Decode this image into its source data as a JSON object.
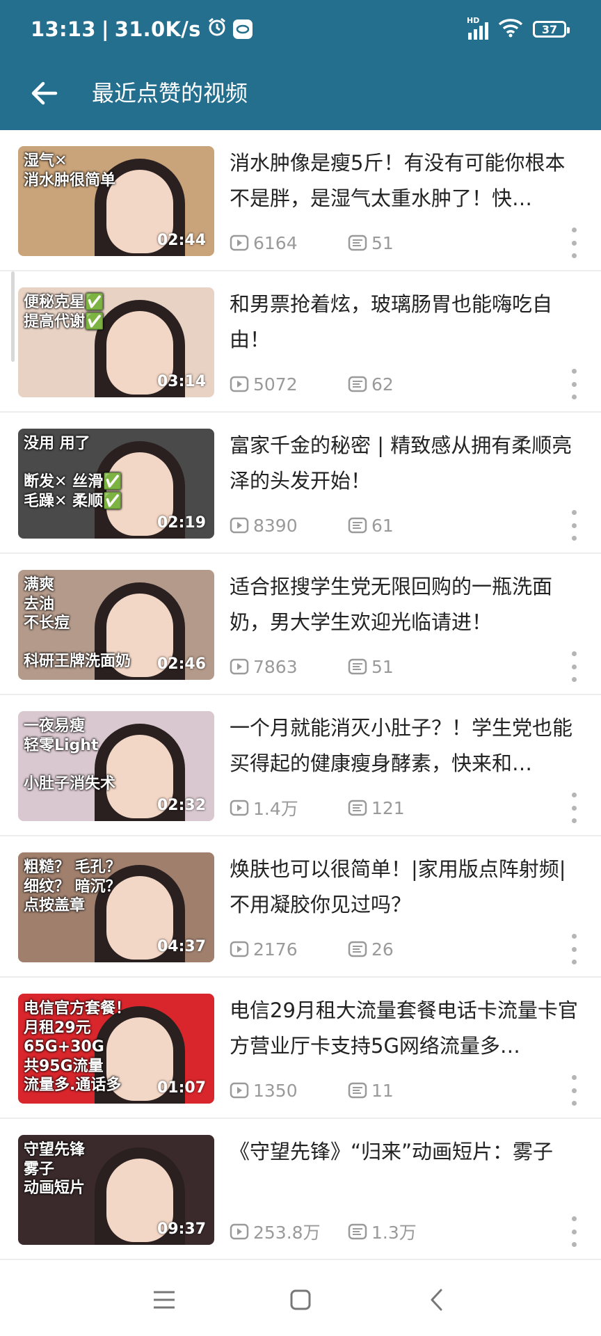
{
  "status_bar": {
    "time": "13:13",
    "separator": "|",
    "speed": "31.0K/s",
    "network": "HD",
    "battery": "37"
  },
  "header": {
    "title": "最近点赞的视频",
    "back_icon": "arrow-left-icon"
  },
  "colors": {
    "topbar": "#246e8e",
    "text": "#222222",
    "meta": "#9a9a9a"
  },
  "videos": [
    {
      "title": "消水肿像是瘦5斤！有没有可能你根本不是胖，是湿气太重水肿了！快…",
      "duration": "02:44",
      "views": "6164",
      "comments": "51",
      "thumb_text": "湿气✕\n消水肿很简单",
      "thumb_bg": "#c9a37a"
    },
    {
      "title": "和男票抢着炫，玻璃肠胃也能嗨吃自由！",
      "duration": "03:14",
      "views": "5072",
      "comments": "62",
      "thumb_text": "便秘克星✅\n提高代谢✅",
      "thumb_bg": "#e8d2c4"
    },
    {
      "title": "富家千金的秘密 | 精致感从拥有柔顺亮泽的头发开始！",
      "duration": "02:19",
      "views": "8390",
      "comments": "61",
      "thumb_text": "没用          用了\n\n断发✕    丝滑✅\n毛躁✕    柔顺✅",
      "thumb_bg": "#4a4a4a"
    },
    {
      "title": "适合抠搜学生党无限回购的一瓶洗面奶，男大学生欢迎光临请进！",
      "duration": "02:46",
      "views": "7863",
      "comments": "51",
      "thumb_text": "满爽\n去油\n不长痘\n\n科研王牌洗面奶",
      "thumb_bg": "#b49a8a"
    },
    {
      "title": "一个月就能消灭小肚子？！学生党也能买得起的健康瘦身酵素，快来和…",
      "duration": "02:32",
      "views": "1.4万",
      "comments": "121",
      "thumb_text": "一夜易瘦\n轻零Light\n\n小肚子消失术",
      "thumb_bg": "#d9c8cf"
    },
    {
      "title": "焕肤也可以很简单！|家用版点阵射频|不用凝胶你见过吗？",
      "duration": "04:37",
      "views": "2176",
      "comments": "26",
      "thumb_text": "粗糙？   毛孔？\n细纹？   暗沉？\n点按盖章",
      "thumb_bg": "#a07f6d"
    },
    {
      "title": "电信29月租大流量套餐电话卡流量卡官方营业厅卡支持5G网络流量多…",
      "duration": "01:07",
      "views": "1350",
      "comments": "11",
      "thumb_text": "电信官方套餐！\n月租29元\n65G+30G\n共95G流量\n流量多.通话多",
      "thumb_bg": "#d8262c"
    },
    {
      "title": "《守望先锋》“归来”动画短片：雾子",
      "duration": "09:37",
      "views": "253.8万",
      "comments": "1.3万",
      "thumb_text": "守望先锋\n雾子\n动画短片",
      "thumb_bg": "#3b2a2c"
    }
  ]
}
